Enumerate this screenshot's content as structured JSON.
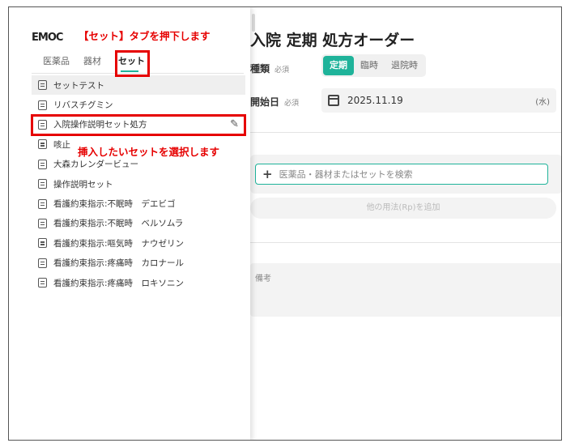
{
  "header": {
    "logo": "EMOC",
    "title": "入院 定期 処方オーダー"
  },
  "form": {
    "type_label": "種類",
    "start_label": "開始日",
    "required": "必須",
    "type_options": [
      "定期",
      "臨時",
      "退院時"
    ],
    "start_date": "2025.11.19",
    "start_dow": "(水)",
    "search_placeholder": "医薬品・器材またはセットを検索",
    "add_rp": "他の用法(Rp)を追加",
    "memo_label": "備考"
  },
  "tabs": [
    "医薬品",
    "器材",
    "セット"
  ],
  "set_items": [
    "セットテスト",
    "リバスチグミン",
    "入院操作説明セット処方",
    "咳止",
    "大森カレンダービュー",
    "操作説明セット",
    "看護約束指示:不眠時　デエビゴ",
    "看護約束指示:不眠時　ベルソムラ",
    "看護約束指示:嘔気時　ナウゼリン",
    "看護約束指示:疼痛時　カロナール",
    "看護約束指示:疼痛時　ロキソニン"
  ],
  "annotations": {
    "tab_note": "【セット】タブを押下します",
    "select_note": "挿入したいセットを選択します"
  },
  "colors": {
    "accent": "#1fb39a",
    "annotation": "#e60000"
  },
  "icons": {
    "item": "document-icon",
    "edit": "pencil-icon",
    "date": "calendar-icon",
    "add": "plus-icon"
  }
}
